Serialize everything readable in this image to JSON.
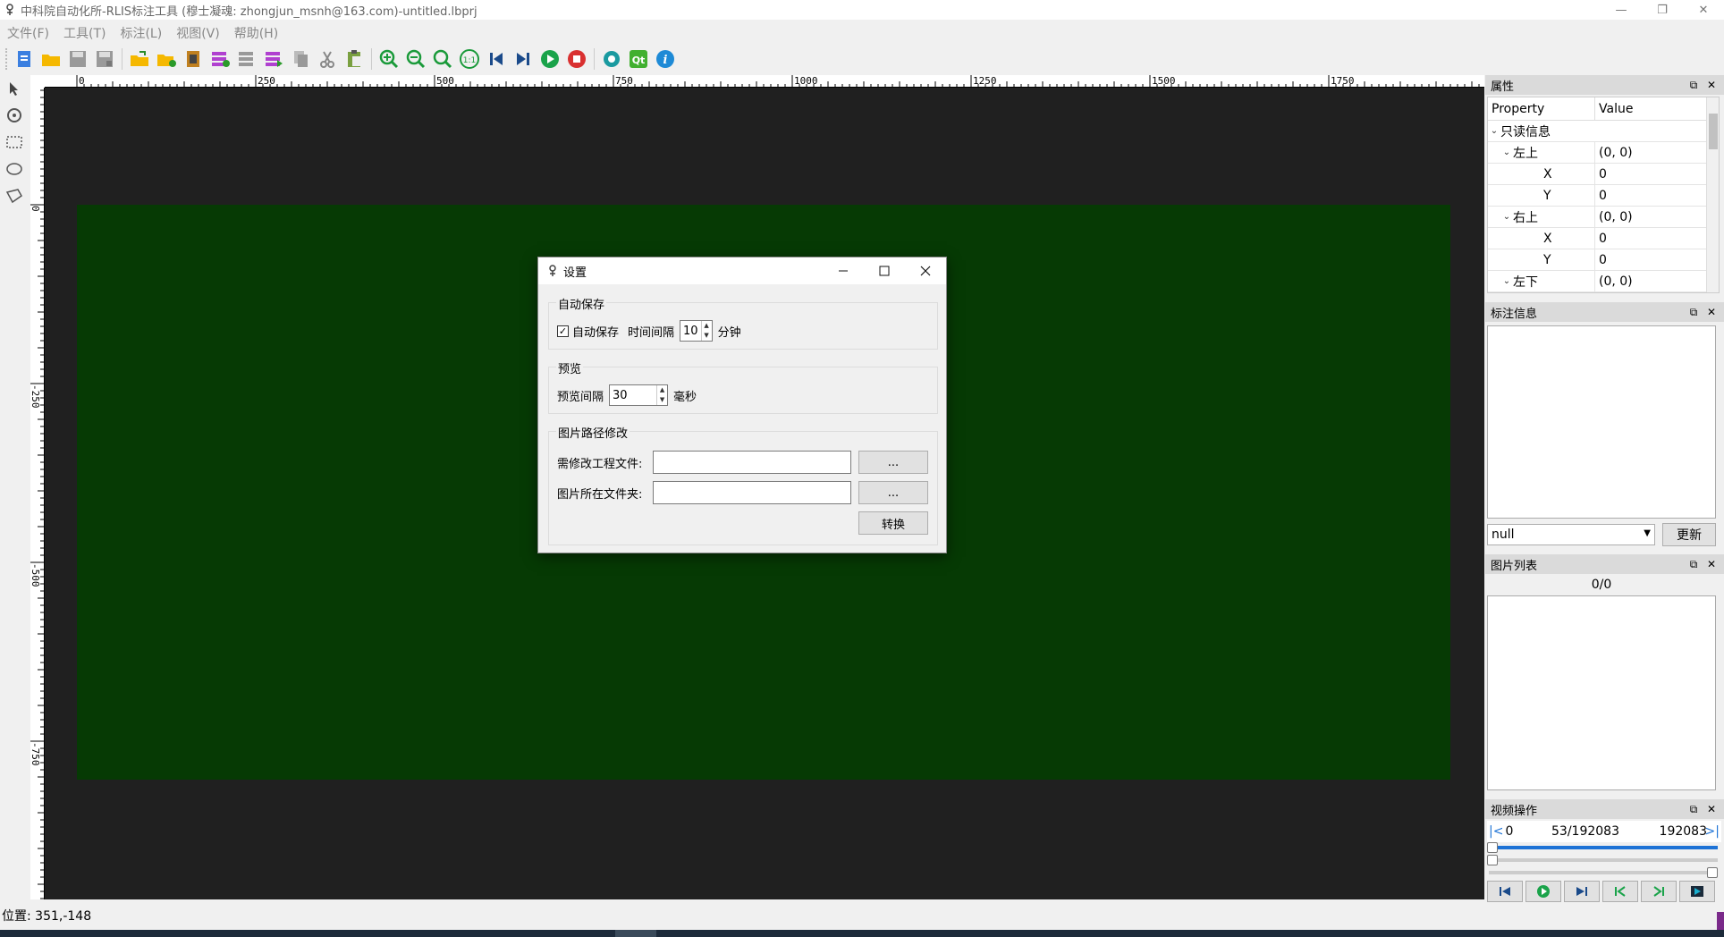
{
  "window": {
    "title": "中科院自动化所-RLIS标注工具 (穆士凝魂: zhongjun_msnh@163.com)-untitled.lbprj",
    "controls": {
      "minimize": "—",
      "restore": "❐",
      "close": "✕"
    }
  },
  "menubar": {
    "items": [
      {
        "label": "文件(F)"
      },
      {
        "label": "工具(T)"
      },
      {
        "label": "标注(L)"
      },
      {
        "label": "视图(V)"
      },
      {
        "label": "帮助(H)"
      }
    ]
  },
  "toolbar": {
    "icons": [
      "new-file-icon",
      "open-folder-icon",
      "save-icon",
      "save-as-icon",
      "open-project-icon",
      "add-folder-icon",
      "film-icon",
      "add-layer-icon",
      "layer-icon",
      "layer-next-icon",
      "copy-icon",
      "cut-icon",
      "paste-icon",
      "zoom-in-icon",
      "zoom-out-icon",
      "zoom-fit-icon",
      "zoom-1to1-icon",
      "first-frame-icon",
      "last-frame-icon",
      "play-icon",
      "stop-icon",
      "settings-icon",
      "qt-icon",
      "info-icon"
    ],
    "zoom_1to1_label": "1:1",
    "qt_label": "Qt",
    "info_label": "i"
  },
  "left_tools": [
    "pointer-icon",
    "rotate-icon",
    "rect-select-icon",
    "ellipse-icon",
    "polygon-icon"
  ],
  "rulers": {
    "top_labels": [
      "0",
      "250",
      "500",
      "750",
      "1000",
      "1250",
      "1500",
      "1750"
    ],
    "left_labels": [
      "0",
      "-250",
      "-500",
      "-750"
    ]
  },
  "colors": {
    "canvas_bg": "#202020",
    "image_bg": "#063a04",
    "accent_blue": "#1e73d6",
    "play_green": "#1aa34a",
    "stop_red": "#d93030"
  },
  "dialog": {
    "title": "设置",
    "autosave": {
      "group_title": "自动保存",
      "checkbox_label": "自动保存",
      "checked": true,
      "interval_label": "时间间隔",
      "interval_value": "10",
      "unit": "分钟"
    },
    "preview": {
      "group_title": "预览",
      "interval_label": "预览间隔",
      "interval_value": "30",
      "unit": "毫秒"
    },
    "path_modify": {
      "group_title": "图片路径修改",
      "project_file_label": "需修改工程文件:",
      "project_file_value": "",
      "image_folder_label": "图片所在文件夹:",
      "image_folder_value": "",
      "browse_label": "...",
      "convert_label": "转换"
    }
  },
  "properties_panel": {
    "title": "属性",
    "header": {
      "property": "Property",
      "value": "Value"
    },
    "rows": [
      {
        "key": "只读信息",
        "value": "",
        "level": 0,
        "expandable": true
      },
      {
        "key": "左上",
        "value": "(0, 0)",
        "level": 1,
        "expandable": true
      },
      {
        "key": "X",
        "value": "0",
        "level": 2,
        "expandable": false
      },
      {
        "key": "Y",
        "value": "0",
        "level": 2,
        "expandable": false
      },
      {
        "key": "右上",
        "value": "(0, 0)",
        "level": 1,
        "expandable": true
      },
      {
        "key": "X",
        "value": "0",
        "level": 2,
        "expandable": false
      },
      {
        "key": "Y",
        "value": "0",
        "level": 2,
        "expandable": false
      },
      {
        "key": "左下",
        "value": "(0, 0)",
        "level": 1,
        "expandable": true
      }
    ]
  },
  "annotation_panel": {
    "title": "标注信息",
    "combo_value": "null",
    "update_label": "更新"
  },
  "image_list_panel": {
    "title": "图片列表",
    "count": "0/0"
  },
  "video_panel": {
    "title": "视频操作",
    "start": "0",
    "current": "53/192083",
    "end": "192083",
    "prev_marker": "|<",
    "next_marker": ">|",
    "progress_fraction": 1.0
  },
  "statusbar": {
    "position_text": "位置: 351,-148"
  }
}
